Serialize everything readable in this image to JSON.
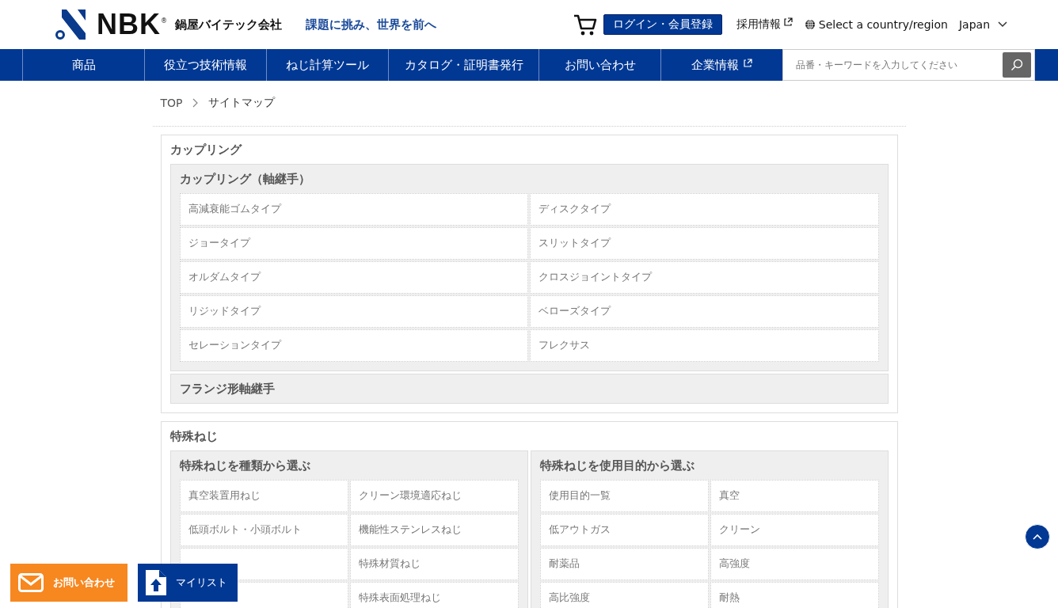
{
  "header": {
    "logo_text": "NBK",
    "logo_mark": "®",
    "company": "鍋屋バイテック会社",
    "tagline": "課題に挑み、世界を前へ",
    "login_button": "ログイン・会員登録",
    "recruit_link": "採用情報",
    "region_label": "Select a country/region",
    "region_value": "Japan"
  },
  "nav": {
    "items": [
      {
        "label": "商品",
        "external": false
      },
      {
        "label": "役立つ技術情報",
        "external": false
      },
      {
        "label": "ねじ計算ツール",
        "external": false
      },
      {
        "label": "カタログ・証明書発行",
        "external": false
      },
      {
        "label": "お問い合わせ",
        "external": false
      },
      {
        "label": "企業情報",
        "external": true
      }
    ],
    "search": {
      "placeholder": "品番・キーワードを入力してください"
    }
  },
  "breadcrumb": [
    "TOP",
    "サイトマップ"
  ],
  "sections": [
    {
      "title": "カップリング",
      "kind": "stacked",
      "groups": [
        {
          "title": "カップリング（軸継手）",
          "items": [
            "高減衰能ゴムタイプ",
            "ディスクタイプ",
            "ジョータイプ",
            "スリットタイプ",
            "オルダムタイプ",
            "クロスジョイントタイプ",
            "リジッドタイプ",
            "ベローズタイプ",
            "セレーションタイプ",
            "フレクサス"
          ]
        },
        {
          "title": "フランジ形軸継手"
        }
      ]
    },
    {
      "title": "特殊ねじ",
      "kind": "side_by_side",
      "groups": [
        {
          "title": "特殊ねじを種類から選ぶ",
          "items": [
            "真空装置用ねじ",
            "クリーン環境適応ねじ",
            "低頭ボルト・小頭ボルト",
            "機能性ステンレスねじ",
            {
              "kind": "blank"
            },
            "特殊材質ねじ",
            {
              "kind": "blank"
            },
            "特殊表面処理ねじ"
          ]
        },
        {
          "title": "特殊ねじを使用目的から選ぶ",
          "items": [
            "使用目的一覧",
            "真空",
            "低アウトガス",
            "クリーン",
            "耐薬品",
            "高強度",
            "高比強度",
            "耐熱"
          ]
        }
      ]
    }
  ],
  "floating_buttons": [
    {
      "kind": "contact",
      "label": "お問い合わせ"
    },
    {
      "kind": "mylist",
      "label": "マイリスト"
    }
  ]
}
